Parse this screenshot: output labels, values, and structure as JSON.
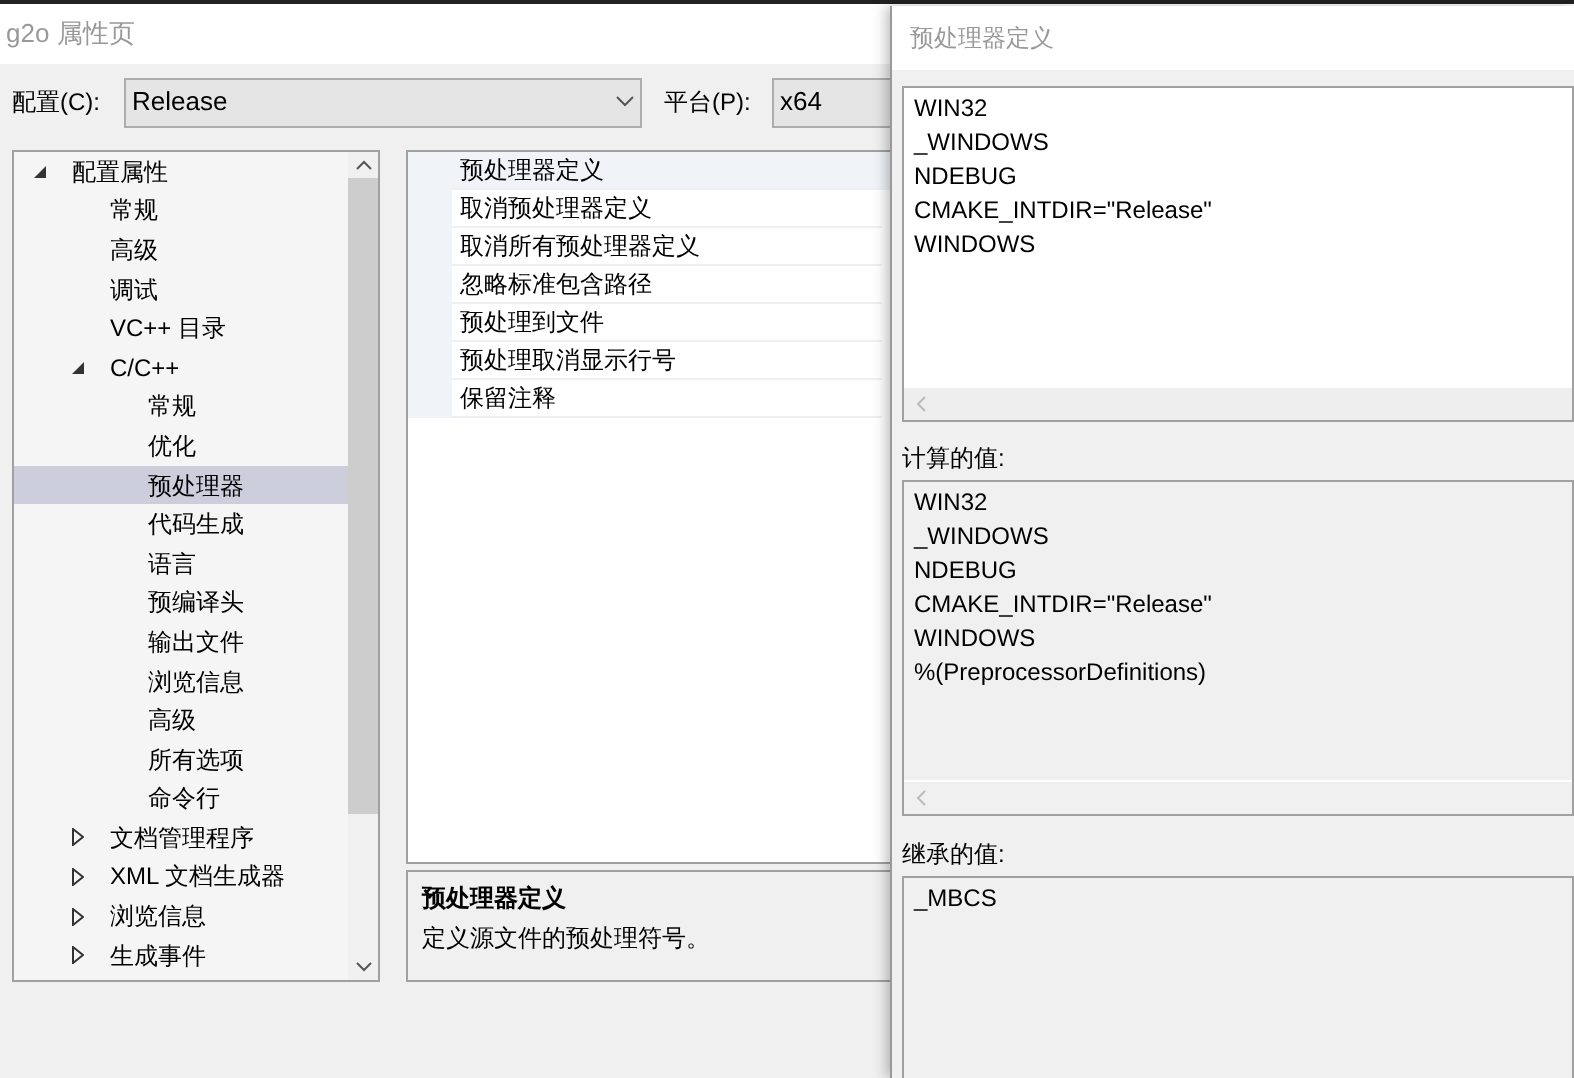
{
  "window": {
    "title": "g2o 属性页"
  },
  "configuration": {
    "label": "配置(C):",
    "value": "Release"
  },
  "platform": {
    "label": "平台(P):",
    "value": "x64"
  },
  "tree": [
    {
      "label": "配置属性",
      "expanded": true,
      "selected": false,
      "children": [
        {
          "label": "常规",
          "selected": false
        },
        {
          "label": "高级",
          "selected": false
        },
        {
          "label": "调试",
          "selected": false
        },
        {
          "label": "VC++ 目录",
          "selected": false
        },
        {
          "label": "C/C++",
          "expanded": true,
          "selected": false,
          "children": [
            {
              "label": "常规",
              "selected": false
            },
            {
              "label": "优化",
              "selected": false
            },
            {
              "label": "预处理器",
              "selected": true
            },
            {
              "label": "代码生成",
              "selected": false
            },
            {
              "label": "语言",
              "selected": false
            },
            {
              "label": "预编译头",
              "selected": false
            },
            {
              "label": "输出文件",
              "selected": false
            },
            {
              "label": "浏览信息",
              "selected": false
            },
            {
              "label": "高级",
              "selected": false
            },
            {
              "label": "所有选项",
              "selected": false
            },
            {
              "label": "命令行",
              "selected": false
            }
          ]
        },
        {
          "label": "文档管理程序",
          "expanded": false,
          "selected": false
        },
        {
          "label": "XML 文档生成器",
          "expanded": false,
          "selected": false
        },
        {
          "label": "浏览信息",
          "expanded": false,
          "selected": false
        },
        {
          "label": "生成事件",
          "expanded": false,
          "selected": false
        }
      ]
    }
  ],
  "properties": [
    {
      "name": "预处理器定义",
      "selected": true
    },
    {
      "name": "取消预处理器定义",
      "selected": false
    },
    {
      "name": "取消所有预处理器定义",
      "selected": false
    },
    {
      "name": "忽略标准包含路径",
      "selected": false
    },
    {
      "name": "预处理到文件",
      "selected": false
    },
    {
      "name": "预处理取消显示行号",
      "selected": false
    },
    {
      "name": "保留注释",
      "selected": false
    }
  ],
  "description": {
    "title": "预处理器定义",
    "text": "定义源文件的预处理符号。"
  },
  "dialog": {
    "title": "预处理器定义",
    "definitions": [
      "WIN32",
      "_WINDOWS",
      "NDEBUG",
      "CMAKE_INTDIR=\"Release\"",
      "WINDOWS"
    ],
    "computed_label": "计算的值:",
    "computed": [
      "WIN32",
      "_WINDOWS",
      "NDEBUG",
      "CMAKE_INTDIR=\"Release\"",
      "WINDOWS",
      "%(PreprocessorDefinitions)"
    ],
    "inherited_label": "继承的值:",
    "inherited": [
      "_MBCS"
    ]
  }
}
